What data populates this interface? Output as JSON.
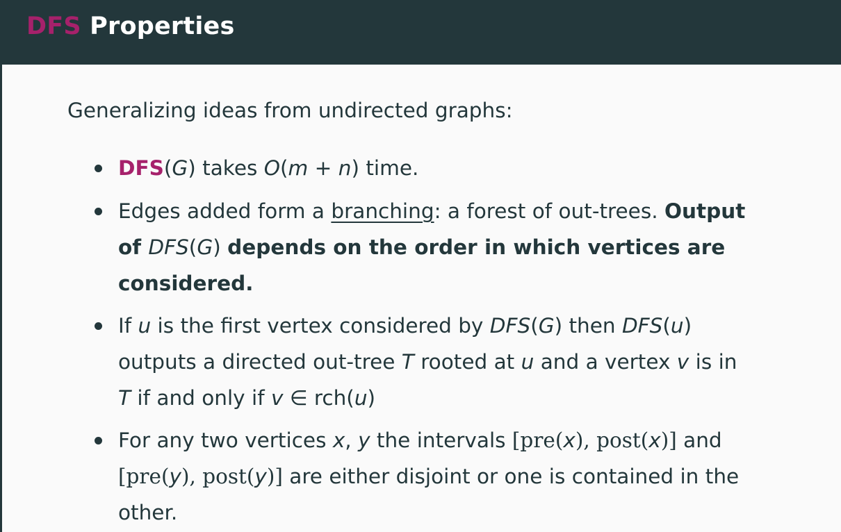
{
  "header": {
    "title_accent": "DFS",
    "title_rest": "Properties"
  },
  "intro": "Generalizing ideas from undirected graphs:",
  "bullets": [
    {
      "lines": [
        [
          {
            "t": "DFS",
            "s": "b accent"
          },
          {
            "t": "(",
            "s": ""
          },
          {
            "t": "G",
            "s": "m"
          },
          {
            "t": ") takes ",
            "s": ""
          },
          {
            "t": "O",
            "s": "m"
          },
          {
            "t": "(",
            "s": ""
          },
          {
            "t": "m",
            "s": "m"
          },
          {
            "t": " + ",
            "s": ""
          },
          {
            "t": "n",
            "s": "m"
          },
          {
            "t": ") time.",
            "s": ""
          }
        ]
      ]
    },
    {
      "lines": [
        [
          {
            "t": "Edges added form a ",
            "s": ""
          },
          {
            "t": "branching",
            "s": "ul"
          },
          {
            "t": ": a forest of out-trees. ",
            "s": ""
          },
          {
            "t": "Output",
            "s": "b"
          }
        ],
        [
          {
            "t": "of ",
            "s": "b"
          },
          {
            "t": "DFS",
            "s": "m"
          },
          {
            "t": "(",
            "s": ""
          },
          {
            "t": "G",
            "s": "m"
          },
          {
            "t": ") ",
            "s": ""
          },
          {
            "t": "depends on the order in which vertices are",
            "s": "b"
          }
        ],
        [
          {
            "t": "considered.",
            "s": "b"
          }
        ]
      ]
    },
    {
      "lines": [
        [
          {
            "t": "If ",
            "s": ""
          },
          {
            "t": "u",
            "s": "m"
          },
          {
            "t": " is the first vertex considered by ",
            "s": ""
          },
          {
            "t": "DFS",
            "s": "m"
          },
          {
            "t": "(",
            "s": ""
          },
          {
            "t": "G",
            "s": "m"
          },
          {
            "t": ") then ",
            "s": ""
          },
          {
            "t": "DFS",
            "s": "m"
          },
          {
            "t": "(",
            "s": ""
          },
          {
            "t": "u",
            "s": "m"
          },
          {
            "t": ")",
            "s": ""
          }
        ],
        [
          {
            "t": "outputs a directed out-tree ",
            "s": ""
          },
          {
            "t": "T",
            "s": "m"
          },
          {
            "t": " rooted at ",
            "s": ""
          },
          {
            "t": "u",
            "s": "m"
          },
          {
            "t": " and a vertex ",
            "s": ""
          },
          {
            "t": "v",
            "s": "m"
          },
          {
            "t": " is in",
            "s": ""
          }
        ],
        [
          {
            "t": "T",
            "s": "m"
          },
          {
            "t": " if and only if ",
            "s": ""
          },
          {
            "t": "v",
            "s": "m"
          },
          {
            "t": " ∈ rch(",
            "s": ""
          },
          {
            "t": "u",
            "s": "m"
          },
          {
            "t": ")",
            "s": ""
          }
        ]
      ]
    },
    {
      "lines": [
        [
          {
            "t": "For any two vertices ",
            "s": ""
          },
          {
            "t": "x",
            "s": "m"
          },
          {
            "t": ", ",
            "s": ""
          },
          {
            "t": "y",
            "s": "m"
          },
          {
            "t": " the intervals ",
            "s": ""
          },
          {
            "t": "[pre(",
            "s": "serif"
          },
          {
            "t": "x",
            "s": "m"
          },
          {
            "t": "), post(",
            "s": "serif"
          },
          {
            "t": "x",
            "s": "m"
          },
          {
            "t": ")]",
            "s": "serif"
          },
          {
            "t": " and",
            "s": ""
          }
        ],
        [
          {
            "t": "[pre(",
            "s": "serif"
          },
          {
            "t": "y",
            "s": "m"
          },
          {
            "t": "), post(",
            "s": "serif"
          },
          {
            "t": "y",
            "s": "m"
          },
          {
            "t": ")]",
            "s": "serif"
          },
          {
            "t": " are either disjoint or one is contained in the",
            "s": ""
          }
        ],
        [
          {
            "t": "other.",
            "s": ""
          }
        ]
      ]
    }
  ],
  "colors": {
    "header_bg": "#23373b",
    "accent": "#a6216b",
    "text": "#23373b",
    "background": "#fafafa"
  }
}
